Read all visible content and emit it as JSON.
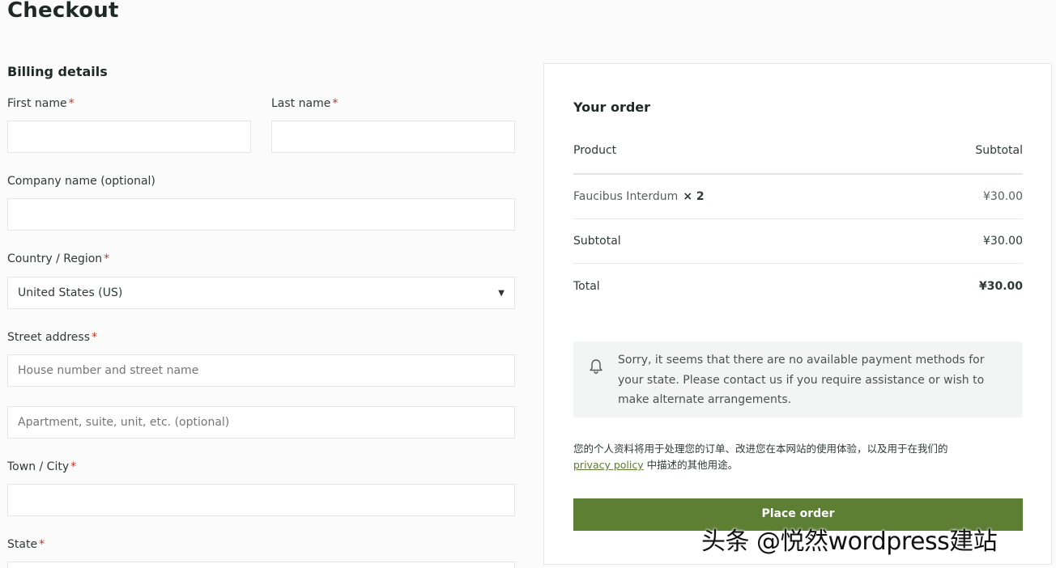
{
  "page": {
    "title": "Checkout"
  },
  "billing": {
    "heading": "Billing details",
    "first_name": {
      "label": "First name",
      "value": ""
    },
    "last_name": {
      "label": "Last name",
      "value": ""
    },
    "company": {
      "label": "Company name (optional)",
      "value": ""
    },
    "country": {
      "label": "Country / Region",
      "selected": "United States (US)"
    },
    "street": {
      "label": "Street address",
      "line1_placeholder": "House number and street name",
      "line2_placeholder": "Apartment, suite, unit, etc. (optional)"
    },
    "city": {
      "label": "Town / City",
      "value": ""
    },
    "state": {
      "label": "State"
    },
    "required_mark": "*"
  },
  "order": {
    "heading": "Your order",
    "col_product": "Product",
    "col_subtotal": "Subtotal",
    "item_name": "Faucibus Interdum",
    "item_qty": "× 2",
    "item_price": "¥30.00",
    "subtotal_label": "Subtotal",
    "subtotal_value": "¥30.00",
    "total_label": "Total",
    "total_value": "¥30.00",
    "notice": "Sorry, it seems that there are no available payment methods for your state. Please contact us if you require assistance or wish to make alternate arrangements.",
    "privacy_before": "您的个人资料将用于处理您的订单、改进您在本网站的使用体验，以及用于在我们的",
    "privacy_link": "privacy policy",
    "privacy_after": "中描述的其他用途。",
    "place_order_label": "Place order"
  },
  "watermark": "头条 @悦然wordpress建站",
  "colors": {
    "accent": "#5c7f34",
    "required": "#c0392b",
    "link": "#5c7a2f"
  },
  "icons": {
    "notice": "bell-icon",
    "select": "chevron-down-icon"
  }
}
